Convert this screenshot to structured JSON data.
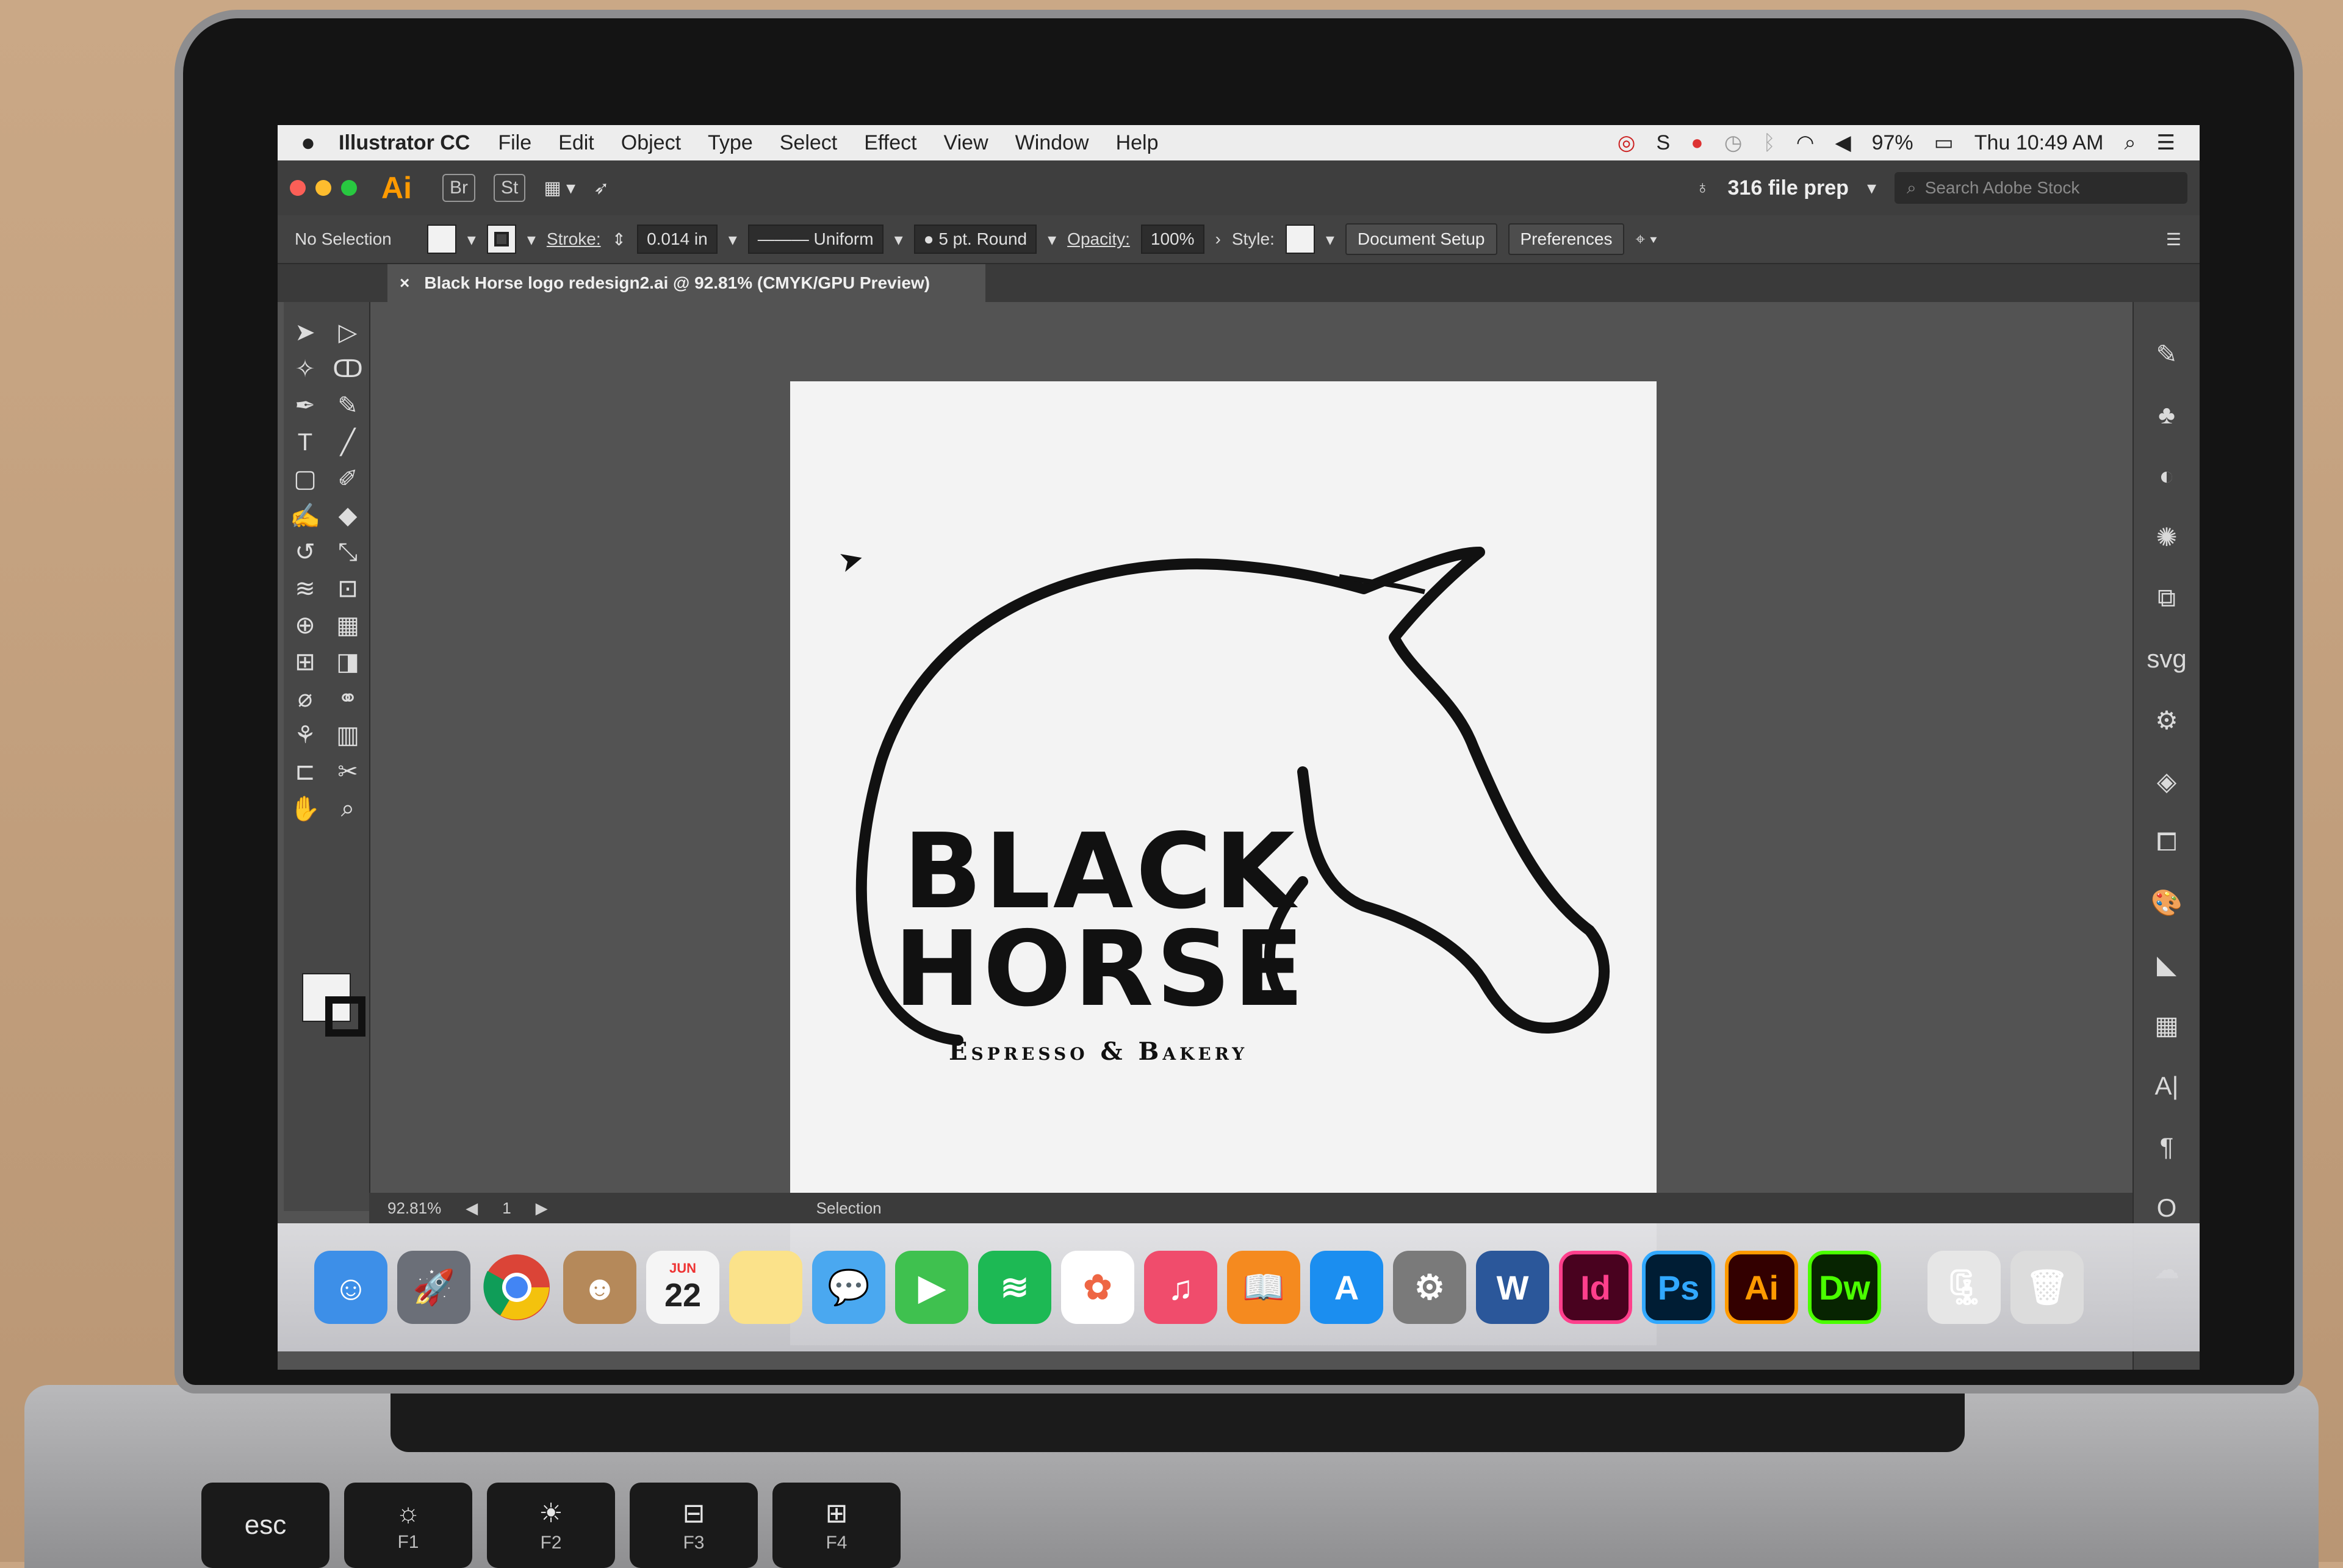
{
  "menubar": {
    "app_name": "Illustrator CC",
    "menus": [
      "File",
      "Edit",
      "Object",
      "Type",
      "Select",
      "Effect",
      "View",
      "Window",
      "Help"
    ],
    "battery": "97%",
    "clock": "Thu 10:49 AM"
  },
  "appbar": {
    "app_logo": "Ai",
    "bridge_label": "Br",
    "stock_label": "St",
    "workspace": "316 file prep",
    "stock_search_placeholder": "Search Adobe Stock"
  },
  "controlbar": {
    "selection_status": "No Selection",
    "stroke_label": "Stroke:",
    "stroke_weight": "0.014 in",
    "stroke_profile": "Uniform",
    "brush": "5 pt. Round",
    "opacity_label": "Opacity:",
    "opacity_value": "100%",
    "style_label": "Style:",
    "document_setup": "Document Setup",
    "preferences": "Preferences"
  },
  "document_tab": {
    "close": "×",
    "title": "Black Horse logo redesign2.ai @ 92.81% (CMYK/GPU Preview)"
  },
  "artwork": {
    "line1": "BLACK",
    "line2": "HORSE",
    "tagline": "Espresso & Bakery"
  },
  "statusbar": {
    "zoom": "92.81%",
    "artboard_number": "1",
    "tool_status": "Selection"
  },
  "dock": {
    "calendar_month": "JUN",
    "calendar_day": "22",
    "app_labels": [
      "Id",
      "Ps",
      "Ai",
      "Dw"
    ]
  },
  "keyboard": {
    "keys": [
      {
        "top": "esc",
        "fn": ""
      },
      {
        "top": "☼",
        "fn": "F1"
      },
      {
        "top": "☀",
        "fn": "F2"
      },
      {
        "top": "⊟",
        "fn": "F3"
      },
      {
        "top": "⊞",
        "fn": "F4"
      }
    ]
  },
  "colors": {
    "ui_dark": "#535353",
    "panel": "#474747",
    "accent_ai": "#ff9a00",
    "artboard": "#f3f3f3"
  }
}
